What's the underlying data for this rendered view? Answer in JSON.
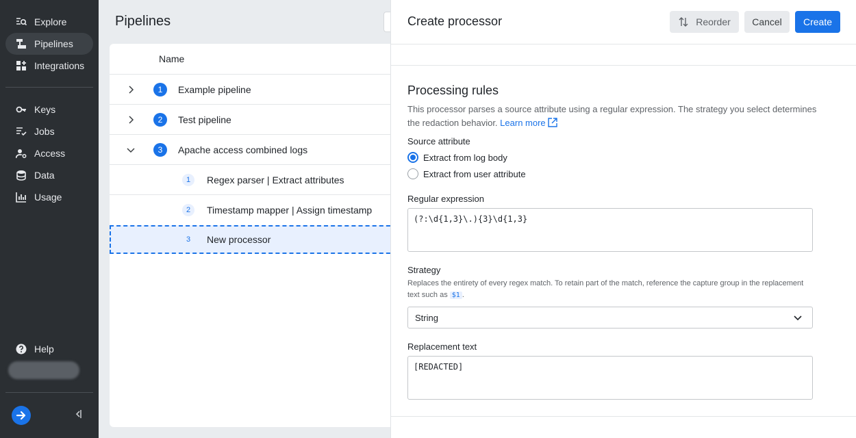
{
  "sidebar": {
    "items": [
      {
        "label": "Explore",
        "icon": "explore-icon"
      },
      {
        "label": "Pipelines",
        "icon": "pipeline-icon"
      },
      {
        "label": "Integrations",
        "icon": "integrations-icon"
      },
      {
        "label": "Keys",
        "icon": "key-icon"
      },
      {
        "label": "Jobs",
        "icon": "jobs-icon"
      },
      {
        "label": "Access",
        "icon": "access-icon"
      },
      {
        "label": "Data",
        "icon": "database-icon"
      },
      {
        "label": "Usage",
        "icon": "bar-chart-icon"
      }
    ],
    "help_label": "Help"
  },
  "main": {
    "title": "Pipelines",
    "table": {
      "header": "Name",
      "rows": [
        {
          "num": "1",
          "label": "Example pipeline"
        },
        {
          "num": "2",
          "label": "Test pipeline"
        },
        {
          "num": "3",
          "label": "Apache access combined logs"
        }
      ],
      "processors": [
        {
          "num": "1",
          "label": "Regex parser  |  Extract attributes"
        },
        {
          "num": "2",
          "label": "Timestamp mapper  |  Assign timestamp"
        },
        {
          "num": "3",
          "label": "New processor"
        }
      ]
    }
  },
  "drawer": {
    "title": "Create processor",
    "reorder_label": "Reorder",
    "cancel_label": "Cancel",
    "create_label": "Create",
    "section_title": "Processing rules",
    "description": "This processor parses a source attribute using a regular expression. The strategy you select determines the redaction behavior.",
    "learn_more": "Learn more",
    "source_attribute": {
      "label": "Source attribute",
      "options": [
        "Extract from log body",
        "Extract from user attribute"
      ],
      "selected": "Extract from log body"
    },
    "regex": {
      "label": "Regular expression",
      "value": "(?:\\d{1,3}\\.){3}\\d{1,3}"
    },
    "strategy": {
      "label": "Strategy",
      "hint_before": "Replaces the entirety of every regex match. To retain part of the match, reference the capture group in the replacement text such as",
      "hint_code": "$1",
      "hint_after": ".",
      "value": "String"
    },
    "replacement": {
      "label": "Replacement text",
      "value": "[REDACTED]"
    }
  },
  "colors": {
    "sidebar_bg": "#2b2f33",
    "accent": "#1a73e8",
    "page_bg": "#e9ecef"
  }
}
